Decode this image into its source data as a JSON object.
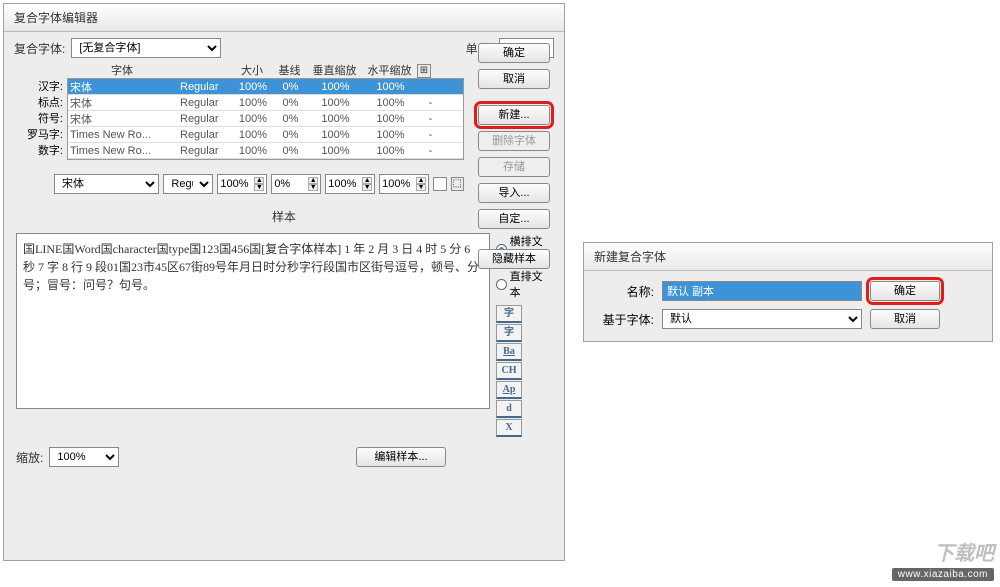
{
  "editor": {
    "title": "复合字体编辑器",
    "compositeFontLabel": "复合字体:",
    "compositeFontValue": "[无复合字体]",
    "unitLabel": "单位:",
    "unitValue": "%",
    "buttons": {
      "ok": "确定",
      "cancel": "取消",
      "new": "新建...",
      "deleteFont": "删除字体",
      "save": "存储",
      "import": "导入...",
      "custom": "自定...",
      "hideSample": "隐藏样本"
    },
    "table": {
      "headers": {
        "font": "字体",
        "size": "大小",
        "baseline": "基线",
        "vscale": "垂直缩放",
        "hscale": "水平缩放"
      },
      "rows": [
        {
          "label": "汉字:",
          "font": "宋体",
          "weight": "Regular",
          "size": "100%",
          "baseline": "0%",
          "vscale": "100%",
          "hscale": "100%",
          "tail": ""
        },
        {
          "label": "标点:",
          "font": "宋体",
          "weight": "Regular",
          "size": "100%",
          "baseline": "0%",
          "vscale": "100%",
          "hscale": "100%",
          "tail": "-"
        },
        {
          "label": "符号:",
          "font": "宋体",
          "weight": "Regular",
          "size": "100%",
          "baseline": "0%",
          "vscale": "100%",
          "hscale": "100%",
          "tail": "-"
        },
        {
          "label": "罗马字:",
          "font": "Times New Ro...",
          "weight": "Regular",
          "size": "100%",
          "baseline": "0%",
          "vscale": "100%",
          "hscale": "100%",
          "tail": "-"
        },
        {
          "label": "数字:",
          "font": "Times New Ro...",
          "weight": "Regular",
          "size": "100%",
          "baseline": "0%",
          "vscale": "100%",
          "hscale": "100%",
          "tail": "-"
        }
      ]
    },
    "midRow": {
      "fontSelect": "宋体",
      "weightSelect": "Regul",
      "v1": "100%",
      "v2": "0%",
      "v3": "100%",
      "v4": "100%"
    },
    "sampleLabel": "样本",
    "sampleText": "国LINE国Word国character国type国123国456国[复合字体样本] 1 年 2 月 3 日 4 时 5 分 6 秒 7 字 8 行 9 段01国23市45区67街89号年月日时分秒字行段国市区街号逗号，顿号、分号；冒号：问号？句号。",
    "sampleSide": {
      "horizontal": "横排文本",
      "vertical": "直排文本",
      "glyphs": [
        "字",
        "字",
        "Ba",
        "CH",
        "Ap",
        "d",
        "X"
      ]
    },
    "zoomLabel": "缩放:",
    "zoomValue": "100%",
    "editSampleBtn": "编辑样本..."
  },
  "newDialog": {
    "title": "新建复合字体",
    "nameLabel": "名称:",
    "nameValue": "默认 副本",
    "basedOnLabel": "基于字体:",
    "basedOnValue": "默认",
    "ok": "确定",
    "cancel": "取消"
  },
  "watermark": {
    "logo": "下载吧",
    "url": "www.xiazaiba.com"
  }
}
